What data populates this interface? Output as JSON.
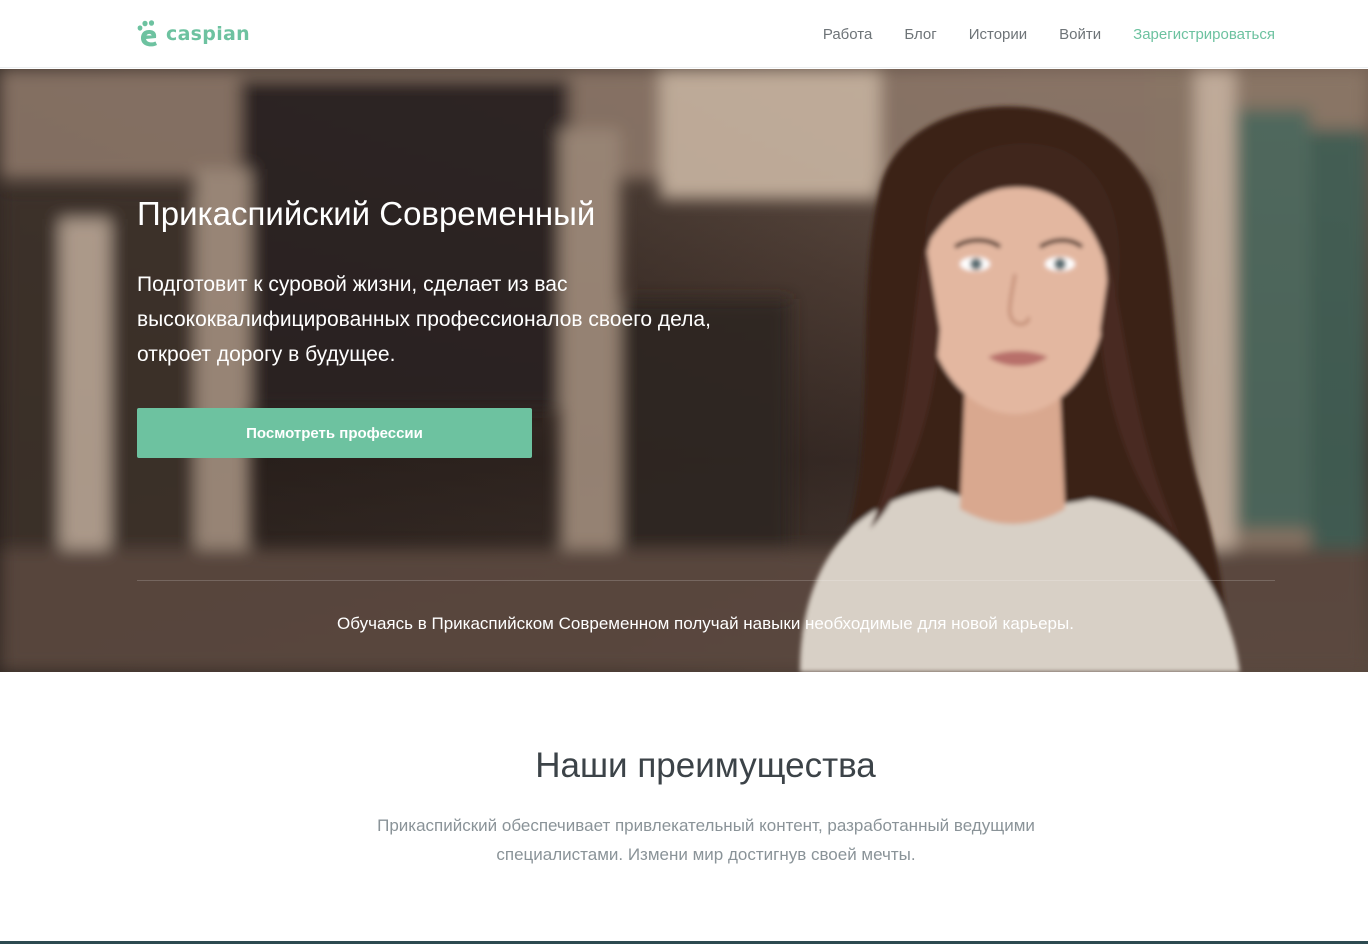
{
  "header": {
    "logo_text": "caspian",
    "nav": [
      {
        "label": "Работа"
      },
      {
        "label": "Блог"
      },
      {
        "label": "Истории"
      },
      {
        "label": "Войти"
      },
      {
        "label": "Зарегистрироваться"
      }
    ]
  },
  "hero": {
    "title": "Прикаспийский Современный",
    "text": "Подготовит к суровой жизни, сделает из вас высококвалифицированных профессионалов своего дела, откроет дорогу в будущее.",
    "button_label": "Посмотреть профессии",
    "caption": "Обучаясь в Прикаспийском Современном получай навыки необходимые для новой карьеры."
  },
  "advantages": {
    "title": "Наши преимущества",
    "text": "Прикаспийский обеспечивает привлекательный контент, разработанный ведущими специалистами. Измени мир достигнув своей мечты."
  },
  "colors": {
    "accent": "#6dc2a0",
    "nav_text": "#6e7478",
    "heading_text": "#3c4348",
    "muted_text": "#8a9398"
  },
  "icons": {
    "logo": "footprint-icon"
  }
}
